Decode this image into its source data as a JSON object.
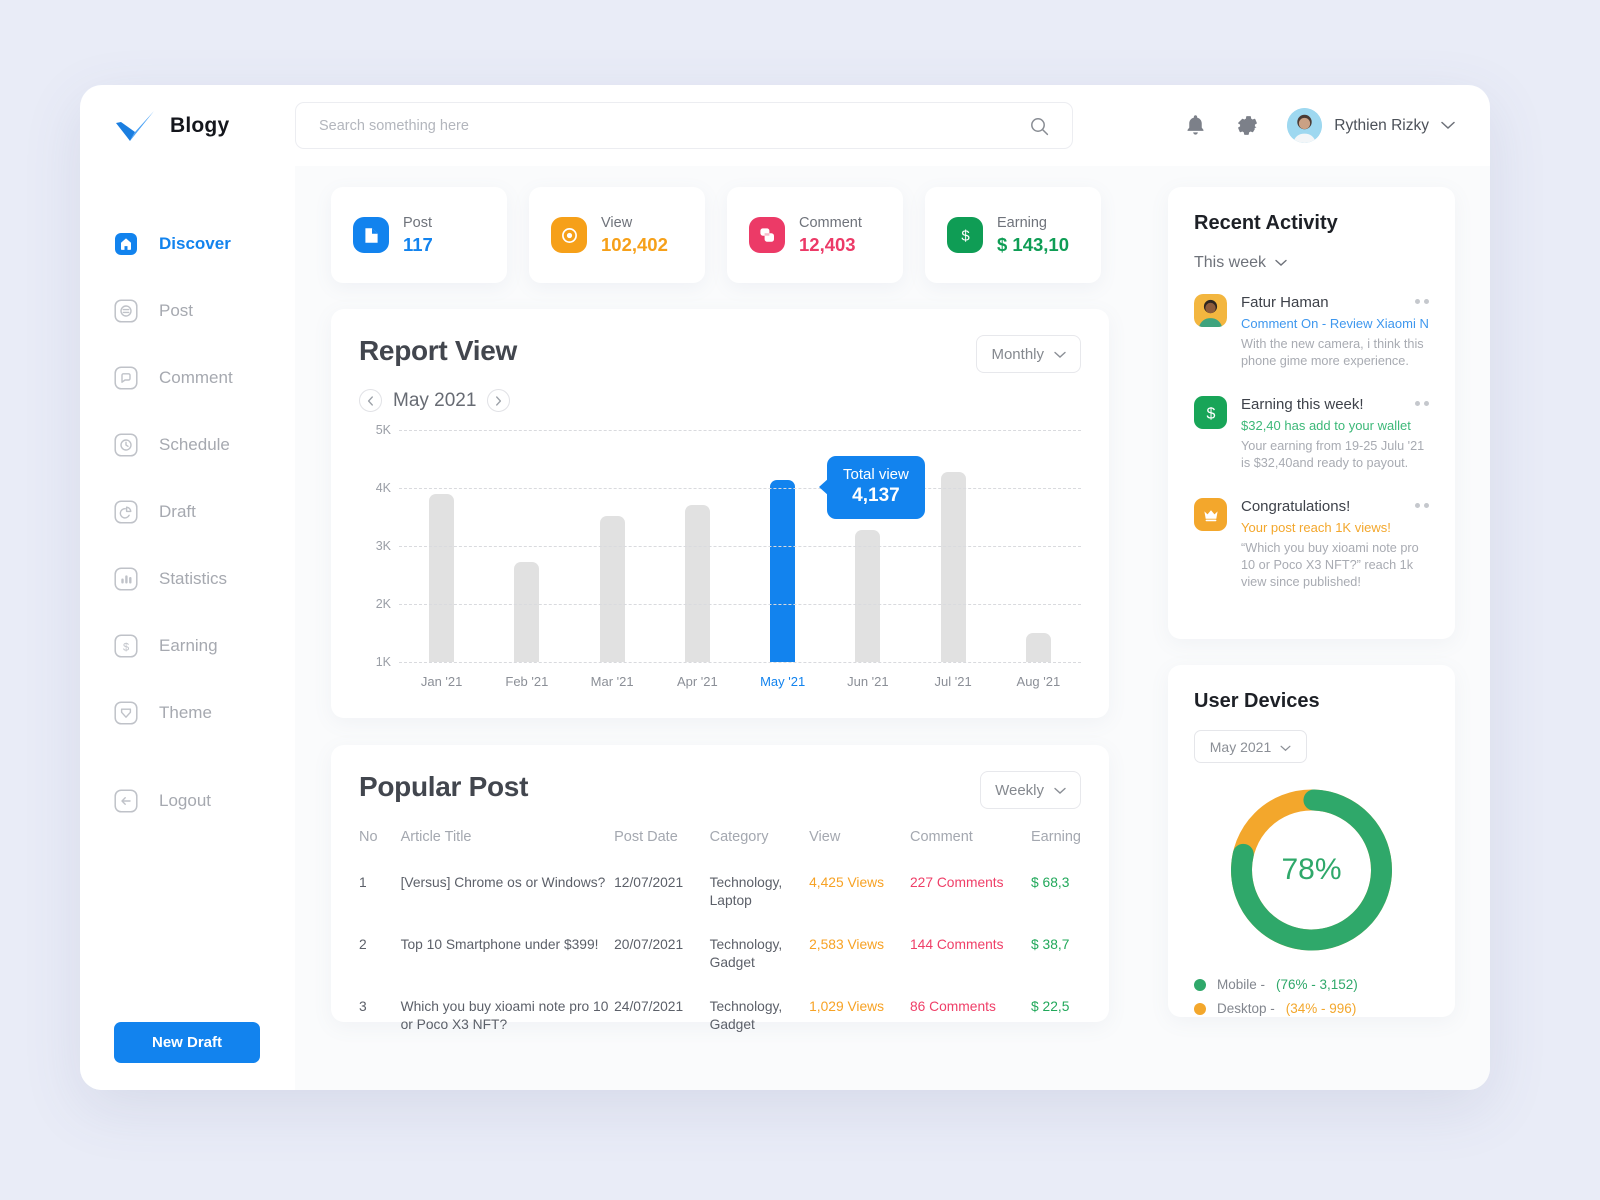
{
  "brand": {
    "name": "Blogy",
    "logo_icon": "checkmark-logo-icon",
    "accent": "#1283ee"
  },
  "search": {
    "placeholder": "Search something here",
    "value": "",
    "icon": "search-icon"
  },
  "header": {
    "bell_icon": "bell-icon",
    "settings_icon": "gear-icon",
    "user_name": "Rythien Rizky",
    "chevron_icon": "chevron-down-icon",
    "avatar_icon": "avatar"
  },
  "sidebar": {
    "items": [
      {
        "label": "Discover",
        "icon": "home-icon",
        "active": true
      },
      {
        "label": "Post",
        "icon": "post-icon",
        "active": false
      },
      {
        "label": "Comment",
        "icon": "comment-icon",
        "active": false
      },
      {
        "label": "Schedule",
        "icon": "clock-icon",
        "active": false
      },
      {
        "label": "Draft",
        "icon": "draft-icon",
        "active": false
      },
      {
        "label": "Statistics",
        "icon": "bar-chart-icon",
        "active": false
      },
      {
        "label": "Earning",
        "icon": "dollar-icon",
        "active": false
      },
      {
        "label": "Theme",
        "icon": "theme-icon",
        "active": false
      }
    ],
    "logout": {
      "label": "Logout",
      "icon": "logout-arrow-icon"
    },
    "new_draft_label": "New Draft"
  },
  "stats": [
    {
      "label": "Post",
      "value": "117",
      "icon": "document-icon",
      "color": "#1283ee"
    },
    {
      "label": "View",
      "value": "102,402",
      "icon": "eye-icon",
      "color": "#f6a019"
    },
    {
      "label": "Comment",
      "value": "12,403",
      "icon": "chat-icon",
      "color": "#ec3a67"
    },
    {
      "label": "Earning",
      "value": "$ 143,10",
      "icon": "dollar-icon",
      "color": "#0f9d55"
    }
  ],
  "report": {
    "title": "Report View",
    "range_label": "Monthly",
    "month_label": "May 2021",
    "prev_icon": "chevron-left-icon",
    "next_icon": "chevron-right-icon",
    "tooltip": {
      "label": "Total view",
      "value": "4,137"
    }
  },
  "chart_data": {
    "type": "bar",
    "title": "Report View",
    "xlabel": "",
    "ylabel": "",
    "categories": [
      "Jan '21",
      "Feb '21",
      "Mar '21",
      "Apr '21",
      "May '21",
      "Jun '21",
      "Jul '21",
      "Aug '21"
    ],
    "values": [
      3900,
      2720,
      3520,
      3700,
      4137,
      3280,
      4270,
      1500
    ],
    "highlight_index": 4,
    "highlight_color": "#1283ee",
    "bar_color": "#e1e1e1",
    "ylim": [
      1000,
      5000
    ],
    "yticks": [
      5000,
      4000,
      3000,
      2000,
      1000
    ],
    "ytick_labels": [
      "5K",
      "4K",
      "3K",
      "2K",
      "1K"
    ],
    "grid": true,
    "legend": false
  },
  "popular": {
    "title": "Popular Post",
    "range_label": "Weekly",
    "columns": [
      "No",
      "Article Title",
      "Post Date",
      "Category",
      "View",
      "Comment",
      "Earning"
    ],
    "rows": [
      {
        "no": "1",
        "title": "[Versus] Chrome os or Windows?",
        "date": "12/07/2021",
        "category": "Technology, Laptop",
        "views": "4,425 Views",
        "comments": "227 Comments",
        "earning": "$ 68,3"
      },
      {
        "no": "2",
        "title": "Top 10 Smartphone under $399!",
        "date": "20/07/2021",
        "category": "Technology, Gadget",
        "views": "2,583 Views",
        "comments": "144 Comments",
        "earning": "$ 38,7"
      },
      {
        "no": "3",
        "title": "Which you buy xioami note pro 10 or Poco X3 NFT?",
        "date": "24/07/2021",
        "category": "Technology, Gadget",
        "views": "1,029 Views",
        "comments": "86 Comments",
        "earning": "$ 22,5"
      }
    ]
  },
  "activity": {
    "title": "Recent Activity",
    "filter_label": "This week",
    "items": [
      {
        "name": "Fatur Haman",
        "sub": "Comment On - Review Xiaomi N",
        "sub_color": "blue",
        "desc": "With the new camera, i think this phone gime more experience.",
        "icon": "user-photo-icon"
      },
      {
        "name": "Earning this week!",
        "sub": "$32,40 has add to your wallet",
        "sub_color": "green",
        "desc": "Your earning from 19-25 Julu '21 is $32,40and ready to payout.",
        "icon": "dollar-icon"
      },
      {
        "name": "Congratulations!",
        "sub": "Your post reach 1K views!",
        "sub_color": "orange",
        "desc": "“Which you buy xioami note pro 10 or Poco X3 NFT?” reach 1k view since published!",
        "icon": "crown-icon"
      }
    ]
  },
  "devices": {
    "title": "User Devices",
    "period_label": "May 2021",
    "center_value": "78%",
    "chart_data": {
      "type": "pie",
      "title": "User Devices",
      "labels": [
        "Mobile",
        "Desktop"
      ],
      "values": [
        76,
        34
      ],
      "colors": [
        "#2fa86a",
        "#f3a72c"
      ],
      "center_label": "78%",
      "legend": true,
      "legend_position": "bottom"
    },
    "legend": [
      {
        "name": "Mobile - ",
        "stat": "(76% - 3,152)",
        "color": "#2fa86a"
      },
      {
        "name": "Desktop - ",
        "stat": "(34% - 996)",
        "color": "#f3a72c"
      }
    ]
  }
}
